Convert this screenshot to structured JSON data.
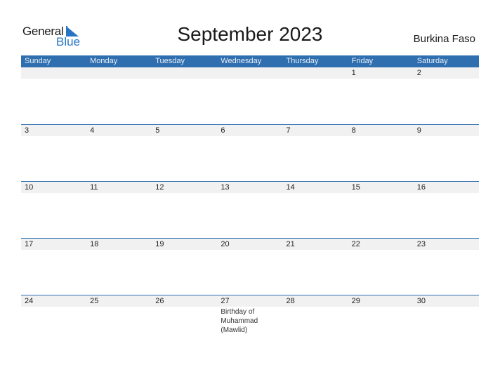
{
  "logo": {
    "word1": "General",
    "word2": "Blue"
  },
  "title": "September 2023",
  "country": "Burkina Faso",
  "colors": {
    "header": "#2f6fb0",
    "strip": "#f1f1f1",
    "brand": "#2874c4"
  },
  "weekdays": [
    "Sunday",
    "Monday",
    "Tuesday",
    "Wednesday",
    "Thursday",
    "Friday",
    "Saturday"
  ],
  "weeks": [
    [
      {
        "d": ""
      },
      {
        "d": ""
      },
      {
        "d": ""
      },
      {
        "d": ""
      },
      {
        "d": ""
      },
      {
        "d": "1"
      },
      {
        "d": "2"
      }
    ],
    [
      {
        "d": "3"
      },
      {
        "d": "4"
      },
      {
        "d": "5"
      },
      {
        "d": "6"
      },
      {
        "d": "7"
      },
      {
        "d": "8"
      },
      {
        "d": "9"
      }
    ],
    [
      {
        "d": "10"
      },
      {
        "d": "11"
      },
      {
        "d": "12"
      },
      {
        "d": "13"
      },
      {
        "d": "14"
      },
      {
        "d": "15"
      },
      {
        "d": "16"
      }
    ],
    [
      {
        "d": "17"
      },
      {
        "d": "18"
      },
      {
        "d": "19"
      },
      {
        "d": "20"
      },
      {
        "d": "21"
      },
      {
        "d": "22"
      },
      {
        "d": "23"
      }
    ],
    [
      {
        "d": "24"
      },
      {
        "d": "25"
      },
      {
        "d": "26"
      },
      {
        "d": "27",
        "event": "Birthday of Muhammad (Mawlid)"
      },
      {
        "d": "28"
      },
      {
        "d": "29"
      },
      {
        "d": "30"
      }
    ]
  ]
}
